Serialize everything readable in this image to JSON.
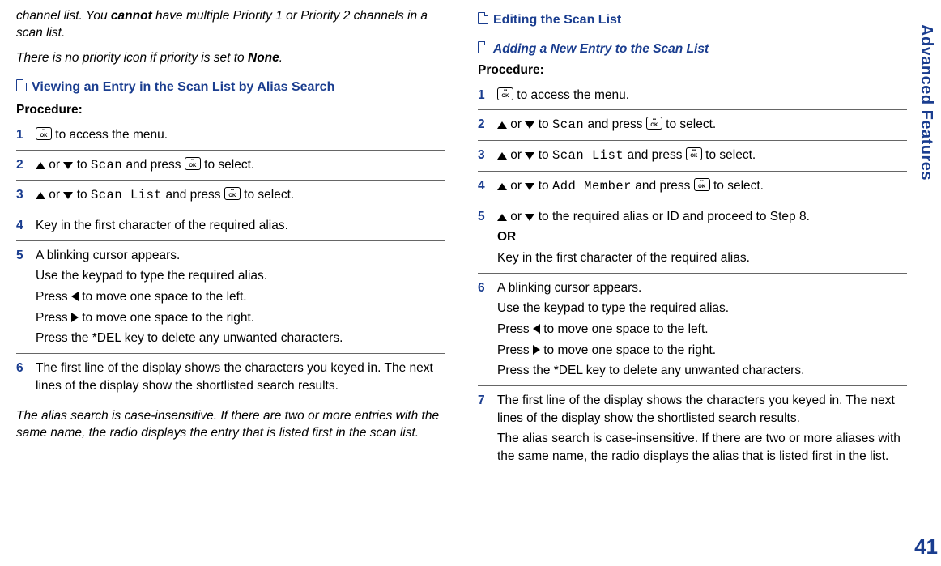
{
  "side_title": "Advanced Features",
  "page_number": "41",
  "okkey": "OK",
  "col1": {
    "intro1_a": "channel list. You ",
    "intro1_b": "cannot",
    "intro1_c": " have multiple Priority 1 or Priority 2 channels in a scan list.",
    "intro2_a": "There is no priority icon if priority is set to ",
    "intro2_b": "None",
    "intro2_c": ".",
    "heading": "Viewing an Entry in the Scan List by Alias Search",
    "procedure": "Procedure:",
    "s1": " to access the menu.",
    "s2_a": " or ",
    "s2_b": " to ",
    "s2_scan": "Scan",
    "s2_c": " and press ",
    "s2_d": " to select.",
    "s3_scanlist": "Scan List",
    "s4": "Key in the first character of the required alias.",
    "s5_l1": "A blinking cursor appears.",
    "s5_l2": "Use the keypad to type the required alias.",
    "s5_l3_a": "Press ",
    "s5_l3_b": " to move one space to the left.",
    "s5_l4_b": " to move one space to the right.",
    "s5_l5": "Press the *DEL key to delete any unwanted characters.",
    "s6": "The first line of the display shows the characters you keyed in. The next lines of the display show the shortlisted search results.",
    "note": "The alias search is case-insensitive. If there are two or more entries with the same name, the radio displays the entry that is listed first in the scan list."
  },
  "col2": {
    "heading": "Editing the Scan List",
    "sub": "Adding a New Entry to the Scan List",
    "procedure": "Procedure:",
    "s1": " to access the menu.",
    "s2_scan": "Scan",
    "s3_scanlist": "Scan List",
    "s4_addmember": "Add Member",
    "s5_l1": " or ",
    "s5_l1b": " to the required alias or ID and proceed to Step 8.",
    "s5_or": "OR",
    "s5_l2": "Key in the first character of the required alias.",
    "s6_l1": "A blinking cursor appears.",
    "s6_l2": "Use the keypad to type the required alias.",
    "s6_l3": " to move one space to the left.",
    "s6_l4": " to move one space to the right.",
    "s6_l5": "Press the *DEL key to delete any unwanted characters.",
    "s7_l1": "The first line of the display shows the characters you keyed in. The next lines of the display show the shortlisted search results.",
    "s7_l2": "The alias search is case-insensitive. If there are two or more aliases with the same name, the radio displays the alias that is listed first in the list.",
    "or_to": " or ",
    "to": " to ",
    "andpress": " and press ",
    "toselect": " to select.",
    "press": "Press "
  }
}
